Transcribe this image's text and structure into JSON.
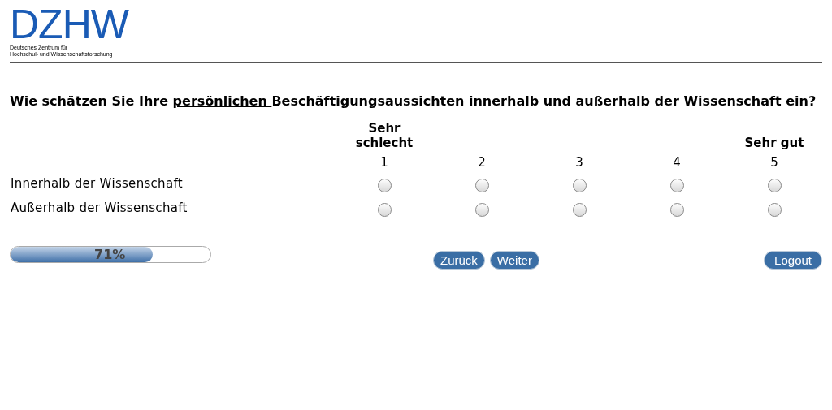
{
  "logo": {
    "mark": "DZHW",
    "subtitle_lines": [
      "Deutsches Zentrum für",
      "Hochschul- und Wissenschaftsforschung"
    ]
  },
  "question": {
    "before": "Wie schätzen Sie Ihre ",
    "underlined": "persönlichen ",
    "after": "Beschäftigungsaussichten innerhalb und außerhalb der Wissenschaft ein?"
  },
  "scale": {
    "anchors": {
      "low": "Sehr schlecht",
      "high": "Sehr gut"
    },
    "numbers": [
      "1",
      "2",
      "3",
      "4",
      "5"
    ]
  },
  "rows": [
    {
      "label": "Innerhalb der Wissenschaft",
      "options": [
        {
          "selected": false
        },
        {
          "selected": false
        },
        {
          "selected": false
        },
        {
          "selected": false
        },
        {
          "selected": false
        }
      ]
    },
    {
      "label": "Außerhalb der Wissenschaft",
      "options": [
        {
          "selected": false
        },
        {
          "selected": false
        },
        {
          "selected": false
        },
        {
          "selected": false
        },
        {
          "selected": false
        }
      ]
    }
  ],
  "progress": {
    "level": 0.71,
    "reading": "71%"
  },
  "buttons": {
    "back": "Zurück",
    "next": "Weiter",
    "logout": "Logout"
  }
}
